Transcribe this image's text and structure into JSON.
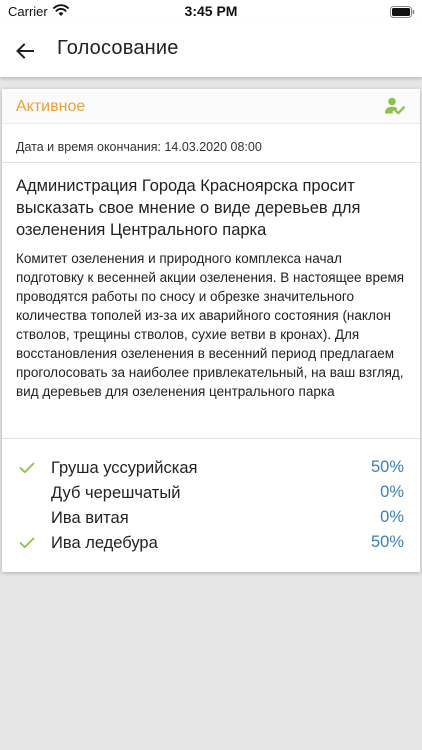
{
  "statusbar": {
    "carrier": "Carrier",
    "time": "3:45 PM"
  },
  "header": {
    "title": "Голосование",
    "back_icon": "arrow-left-icon"
  },
  "poll": {
    "status": "Активное",
    "status_color": "#e9a13a",
    "voted_icon": "user-check-icon",
    "voted_icon_color": "#8bc34a",
    "end_date": "Дата и время окончания: 14.03.2020 08:00",
    "title": "Администрация Города Красноярска просит высказать свое мнение о виде деревьев для озеленения Центрального парка",
    "description": "Комитет озеленения и природного комплекса начал подготовку к весенней акции озеленения. В настоящее время проводятся работы по сносу и обрезке значительного количества тополей из-за их аварийного состояния (наклон стволов, трещины стволов, сухие ветви в кронах). Для восстановления озеленения в весенний период предлагаем проголосовать за наиболее привлекательный, на ваш взгляд, вид деревьев для озеленения центрального парка",
    "percent_color": "#3a7fb8",
    "options": [
      {
        "label": "Груша уссурийская",
        "percent": "50%",
        "selected": true
      },
      {
        "label": "Дуб черешчатый",
        "percent": "0%",
        "selected": false
      },
      {
        "label": "Ива витая",
        "percent": "0%",
        "selected": false
      },
      {
        "label": "Ива ледебура",
        "percent": "50%",
        "selected": true
      }
    ]
  }
}
